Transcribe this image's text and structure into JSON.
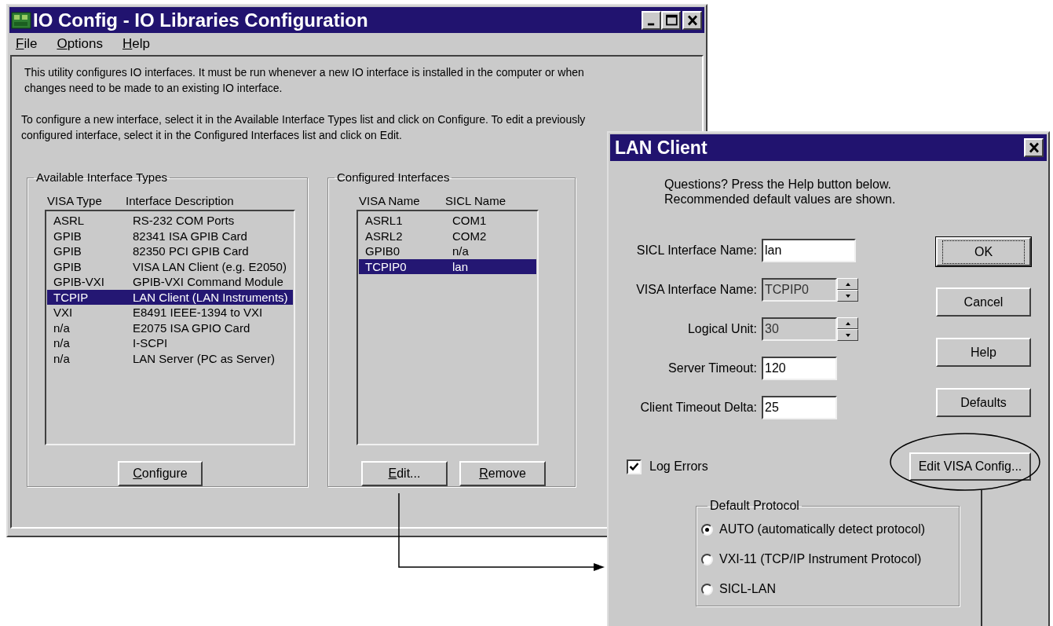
{
  "main_window": {
    "title": "IO Config - IO Libraries Configuration",
    "menu": [
      "File",
      "Options",
      "Help"
    ],
    "intro_text": [
      "This utility configures IO interfaces.  It must be run whenever a new IO interface is installed in the computer or when\nchanges need to be made to an existing IO interface.",
      "To configure a new interface, select it in the Available Interface Types list and click on Configure.  To edit a previously\nconfigured interface, select it in the Configured Interfaces list and click on Edit."
    ],
    "available_interface_types": {
      "title": "Available Interface Types",
      "columns": [
        "VISA Type",
        "Interface Description"
      ],
      "rows": [
        {
          "cells": [
            "ASRL",
            "RS-232 COM Ports"
          ],
          "selected": false
        },
        {
          "cells": [
            "GPIB",
            "82341 ISA GPIB Card"
          ],
          "selected": false
        },
        {
          "cells": [
            "GPIB",
            "82350 PCI GPIB Card"
          ],
          "selected": false
        },
        {
          "cells": [
            "GPIB",
            "VISA LAN Client (e.g. E2050)"
          ],
          "selected": false
        },
        {
          "cells": [
            "GPIB-VXI",
            "GPIB-VXI Command Module"
          ],
          "selected": false
        },
        {
          "cells": [
            "TCPIP",
            "LAN Client (LAN Instruments)"
          ],
          "selected": true
        },
        {
          "cells": [
            "VXI",
            "E8491 IEEE-1394 to VXI"
          ],
          "selected": false
        },
        {
          "cells": [
            "n/a",
            "E2075 ISA GPIO Card"
          ],
          "selected": false
        },
        {
          "cells": [
            "n/a",
            "I-SCPI"
          ],
          "selected": false
        },
        {
          "cells": [
            "n/a",
            "LAN Server (PC as Server)"
          ],
          "selected": false
        }
      ],
      "buttons": [
        "Configure"
      ]
    },
    "configured_interfaces": {
      "title": "Configured Interfaces",
      "columns": [
        "VISA Name",
        "SICL Name"
      ],
      "rows": [
        {
          "cells": [
            "ASRL1",
            "COM1"
          ],
          "selected": false
        },
        {
          "cells": [
            "ASRL2",
            "COM2"
          ],
          "selected": false
        },
        {
          "cells": [
            "GPIB0",
            "n/a"
          ],
          "selected": false
        },
        {
          "cells": [
            "TCPIP0",
            "lan"
          ],
          "selected": true
        }
      ],
      "buttons": [
        "Edit...",
        "Remove"
      ]
    }
  },
  "dialog": {
    "title": "LAN Client",
    "help_text": "Questions?  Press the Help button below.\nRecommended default values are shown.",
    "fields": [
      {
        "label": "SICL Interface Name:",
        "value": "lan",
        "kind": "text"
      },
      {
        "label": "VISA Interface Name:",
        "value": "TCPIP0",
        "kind": "spinner"
      },
      {
        "label": "Logical Unit:",
        "value": "30",
        "kind": "spinner"
      },
      {
        "label": "Server Timeout:",
        "value": "120",
        "kind": "text"
      },
      {
        "label": "Client Timeout Delta:",
        "value": "25",
        "kind": "text"
      }
    ],
    "buttons": [
      {
        "label": "OK",
        "default": true
      },
      {
        "label": "Cancel",
        "default": false
      },
      {
        "label": "Help",
        "default": false
      },
      {
        "label": "Defaults",
        "default": false
      }
    ],
    "log_errors": {
      "label": "Log Errors",
      "checked": true
    },
    "edit_visa_button": "Edit VISA Config...",
    "protocol": {
      "title": "Default Protocol",
      "options": [
        {
          "label": "AUTO (automatically detect protocol)",
          "selected": true
        },
        {
          "label": "VXI-11 (TCP/IP Instrument Protocol)",
          "selected": false
        },
        {
          "label": "SICL-LAN",
          "selected": false
        }
      ]
    }
  }
}
